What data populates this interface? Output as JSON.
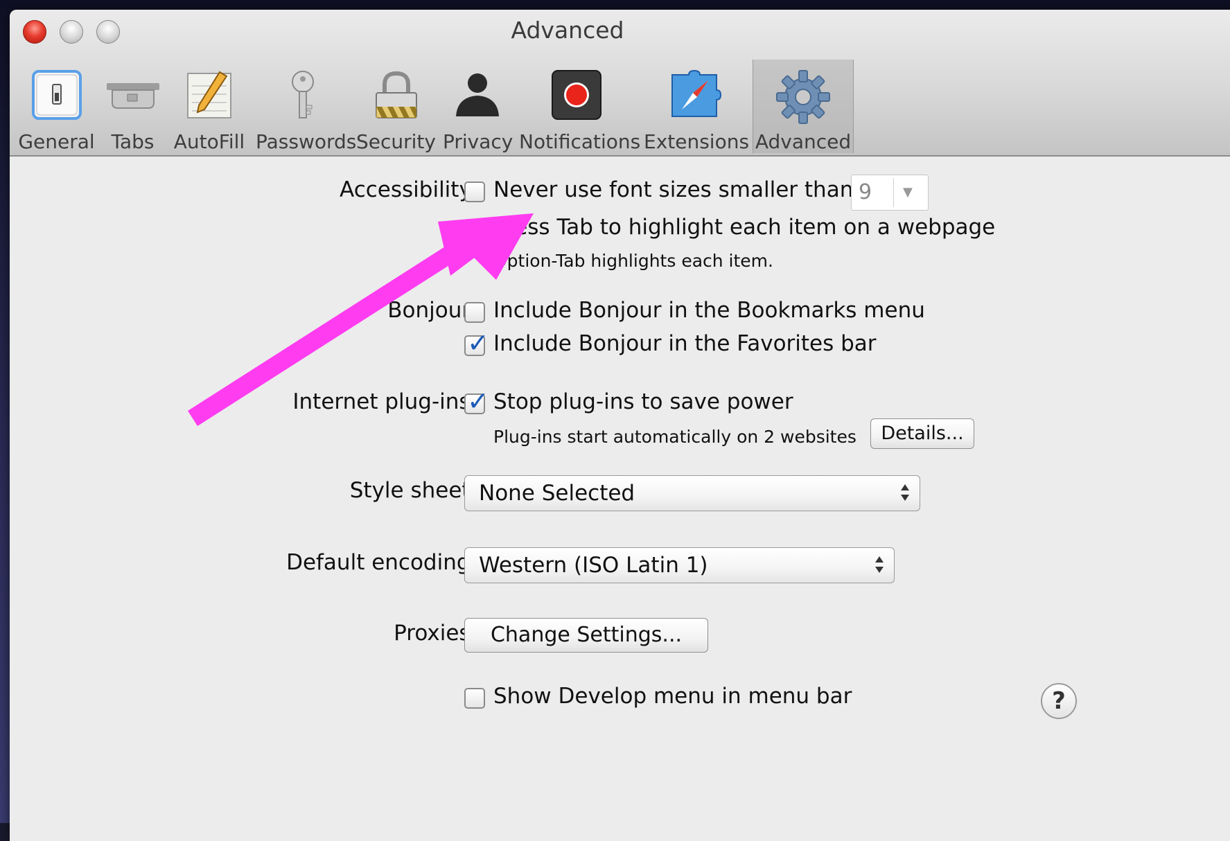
{
  "window": {
    "title": "Advanced"
  },
  "toolbar": {
    "items": [
      {
        "label": "General",
        "icon": "switch-icon"
      },
      {
        "label": "Tabs",
        "icon": "tabs-icon"
      },
      {
        "label": "AutoFill",
        "icon": "pencil-notepad-icon"
      },
      {
        "label": "Passwords",
        "icon": "key-icon"
      },
      {
        "label": "Security",
        "icon": "padlock-icon"
      },
      {
        "label": "Privacy",
        "icon": "person-silhouette-icon"
      },
      {
        "label": "Notifications",
        "icon": "record-dot-icon"
      },
      {
        "label": "Extensions",
        "icon": "compass-puzzle-icon"
      },
      {
        "label": "Advanced",
        "icon": "gear-icon"
      }
    ],
    "selected": "Advanced"
  },
  "settings": {
    "accessibility": {
      "label": "Accessibility:",
      "font_size": {
        "label": "Never use font sizes smaller than",
        "checked": false,
        "value": "9"
      },
      "press_tab": {
        "label": "Press Tab to highlight each item on a webpage",
        "checked": false,
        "hint": "Option-Tab highlights each item."
      }
    },
    "bonjour": {
      "label": "Bonjour:",
      "bookmarks": {
        "label": "Include Bonjour in the Bookmarks menu",
        "checked": false
      },
      "favorites": {
        "label": "Include Bonjour in the Favorites bar",
        "checked": true
      }
    },
    "plugins": {
      "label": "Internet plug-ins:",
      "stop_plugins": {
        "label": "Stop plug-ins to save power",
        "checked": true
      },
      "hint": "Plug-ins start automatically on 2 websites",
      "details_button": "Details..."
    },
    "style_sheet": {
      "label": "Style sheet:",
      "value": "None Selected"
    },
    "encoding": {
      "label": "Default encoding:",
      "value": "Western (ISO Latin 1)"
    },
    "proxies": {
      "label": "Proxies:",
      "button": "Change Settings..."
    },
    "develop": {
      "label": "Show Develop menu in menu bar",
      "checked": false
    }
  },
  "help_button": "?",
  "annotation": {
    "color": "#ff3cf0",
    "type": "arrow-pointing-to-font-size-checkbox"
  },
  "colors": {
    "checkmark": "#1c5bb8",
    "close_button": "#e63b2e",
    "selected_tab": "#b9b9b9"
  }
}
